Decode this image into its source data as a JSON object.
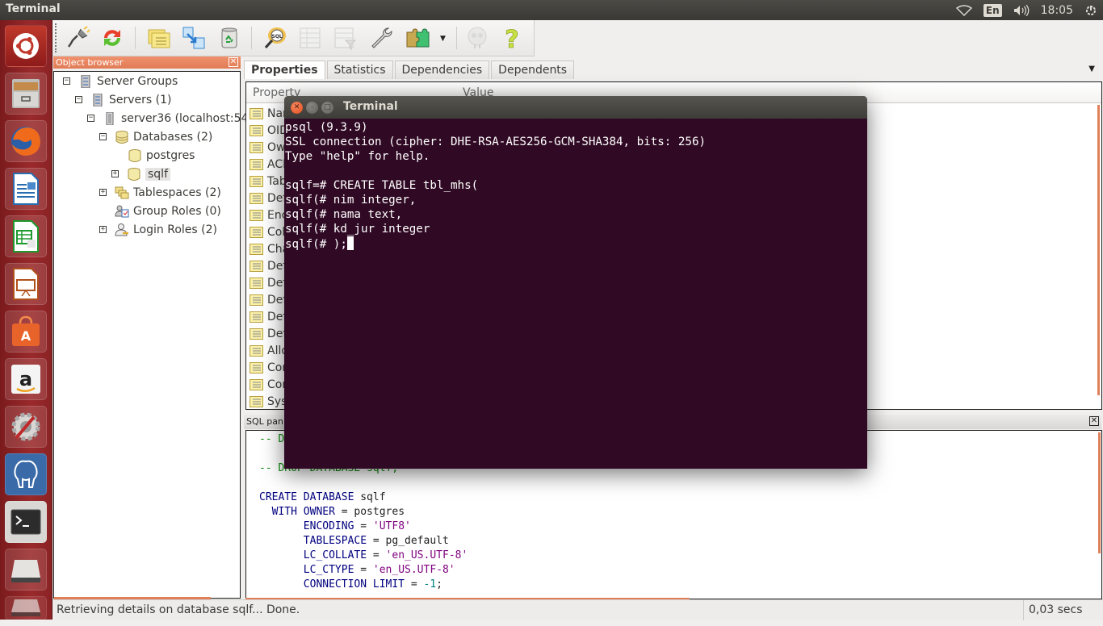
{
  "topbar": {
    "app_title": "Terminal",
    "tray": {
      "network_icon": "wifi-icon",
      "keyboard_layout": "En",
      "volume_icon": "speaker-icon",
      "clock": "18:05",
      "session_icon": "power-gear-icon"
    }
  },
  "launcher": {
    "items": [
      {
        "name": "Dash Home",
        "icon": "ubuntu-logo-icon"
      },
      {
        "name": "Files",
        "icon": "file-cabinet-icon"
      },
      {
        "name": "Firefox",
        "icon": "firefox-icon"
      },
      {
        "name": "LibreOffice Writer",
        "icon": "writer-icon"
      },
      {
        "name": "LibreOffice Calc",
        "icon": "calc-icon"
      },
      {
        "name": "LibreOffice Impress",
        "icon": "impress-icon"
      },
      {
        "name": "Ubuntu Software Center",
        "icon": "software-center-icon"
      },
      {
        "name": "Amazon",
        "icon": "amazon-icon"
      },
      {
        "name": "System Settings",
        "icon": "settings-icon"
      },
      {
        "name": "pgAdmin III",
        "icon": "postgres-elephant-icon"
      },
      {
        "name": "Terminal",
        "icon": "terminal-icon"
      },
      {
        "name": "Drive",
        "icon": "drive-icon"
      },
      {
        "name": "Drive",
        "icon": "drive-icon"
      }
    ]
  },
  "toolbar": {
    "buttons": [
      {
        "name": "connect",
        "icon": "plug-icon"
      },
      {
        "name": "refresh",
        "icon": "refresh-icon"
      },
      {
        "name": "properties",
        "icon": "properties-folder-icon"
      },
      {
        "name": "create",
        "icon": "create-object-icon"
      },
      {
        "name": "drop",
        "icon": "trash-icon"
      },
      {
        "name": "query-tool",
        "icon": "sql-query-icon"
      },
      {
        "name": "view-data",
        "icon": "table-icon"
      },
      {
        "name": "filtered-data",
        "icon": "filter-table-icon"
      },
      {
        "name": "maintenance",
        "icon": "wrench-icon"
      },
      {
        "name": "plugins",
        "icon": "puzzle-icon"
      },
      {
        "name": "hints",
        "icon": "guru-icon"
      },
      {
        "name": "help",
        "icon": "help-question-icon"
      }
    ]
  },
  "object_browser": {
    "title": "Object browser",
    "tree": [
      {
        "label": "Server Groups",
        "expander": "−",
        "icon": "server-group-icon"
      },
      {
        "label": "Servers (1)",
        "expander": "−",
        "icon": "servers-icon"
      },
      {
        "label": "server36 (localhost:54",
        "expander": "−",
        "icon": "server-icon"
      },
      {
        "label": "Databases (2)",
        "expander": "−",
        "icon": "databases-icon"
      },
      {
        "label": "postgres",
        "expander": "",
        "icon": "database-icon"
      },
      {
        "label": "sqlf",
        "expander": "+",
        "icon": "database-icon",
        "selected": true
      },
      {
        "label": "Tablespaces (2)",
        "expander": "+",
        "icon": "tablespaces-icon"
      },
      {
        "label": "Group Roles (0)",
        "expander": "",
        "icon": "group-roles-icon"
      },
      {
        "label": "Login Roles (2)",
        "expander": "+",
        "icon": "login-roles-icon"
      }
    ]
  },
  "properties_pane": {
    "tabs": [
      {
        "label": "Properties",
        "active": true
      },
      {
        "label": "Statistics",
        "active": false
      },
      {
        "label": "Dependencies",
        "active": false
      },
      {
        "label": "Dependents",
        "active": false
      }
    ],
    "columns": {
      "property": "Property",
      "value": "Value"
    },
    "rows": [
      "Nar",
      "OID",
      "Ow",
      "ACL",
      "Tab",
      "Def",
      "Enc",
      "Col",
      "Cha",
      "Def",
      "Def",
      "Def",
      "Def",
      "Def",
      "Allo",
      "Cor",
      "Cor",
      "Sys"
    ]
  },
  "sql_pane": {
    "title": "SQL pan",
    "lines": [
      [
        {
          "t": "-- D",
          "c": "cm"
        }
      ],
      [],
      [
        {
          "t": "-- DROP DATABASE sqlf;",
          "c": "cm"
        }
      ],
      [],
      [
        {
          "t": "CREATE DATABASE",
          "c": "kw"
        },
        {
          "t": " sqlf",
          "c": "txt"
        }
      ],
      [
        {
          "t": "  WITH OWNER",
          "c": "kw"
        },
        {
          "t": " = postgres",
          "c": "txt"
        }
      ],
      [
        {
          "t": "       ENCODING",
          "c": "kw"
        },
        {
          "t": " = ",
          "c": "txt"
        },
        {
          "t": "'UTF8'",
          "c": "str"
        }
      ],
      [
        {
          "t": "       TABLESPACE",
          "c": "kw"
        },
        {
          "t": " = pg_default",
          "c": "txt"
        }
      ],
      [
        {
          "t": "       LC_COLLATE",
          "c": "kw"
        },
        {
          "t": " = ",
          "c": "txt"
        },
        {
          "t": "'en_US.UTF-8'",
          "c": "str"
        }
      ],
      [
        {
          "t": "       LC_CTYPE",
          "c": "kw"
        },
        {
          "t": " = ",
          "c": "txt"
        },
        {
          "t": "'en_US.UTF-8'",
          "c": "str"
        }
      ],
      [
        {
          "t": "       CONNECTION LIMIT",
          "c": "kw"
        },
        {
          "t": " = ",
          "c": "txt"
        },
        {
          "t": "-1",
          "c": "num"
        },
        {
          "t": ";",
          "c": "txt"
        }
      ]
    ]
  },
  "statusbar": {
    "message": "Retrieving details on database sqlf... Done.",
    "elapsed": "0,03 secs"
  },
  "terminal": {
    "title": "Terminal",
    "lines": [
      "psql (9.3.9)",
      "SSL connection (cipher: DHE-RSA-AES256-GCM-SHA384, bits: 256)",
      "Type \"help\" for help.",
      "",
      "sqlf=# CREATE TABLE tbl_mhs(",
      "sqlf(# nim integer,",
      "sqlf(# nama text,",
      "sqlf(# kd_jur integer",
      "sqlf(# );"
    ]
  },
  "colors": {
    "launcher_bg": "#8a2224",
    "panel_accent": "#e07b55",
    "terminal_bg": "#300a24",
    "sql_keyword": "#00007f",
    "sql_string": "#7f007f",
    "sql_comment": "#0a8a0a"
  }
}
